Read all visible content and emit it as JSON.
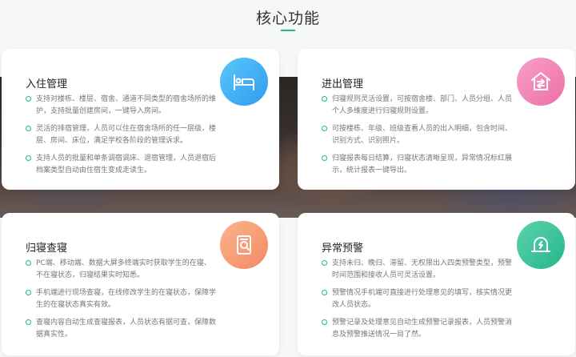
{
  "page": {
    "title": "核心功能"
  },
  "cards": [
    {
      "title": "入住管理",
      "icon": "bed-icon",
      "items": [
        "支持对楼栋、楼层、宿舍、通道不同类型的宿舍场所的维护，支持批量创建房间，一键导入房间。",
        "灵活的排宿管理，人员可以住在宿舍场所的任一层级，楼层、房间、床位，满足学校各阶段的管理诉求。",
        "支持人员的批量和单条调宿调床、退宿管理，人员退宿后档案类型自动由住宿生变成走读生。"
      ]
    },
    {
      "title": "进出管理",
      "icon": "building-in-out-icon",
      "items": [
        "归寝规则灵活设置，可按宿舍楼、部门、人员分组、人员个人多维度进行归寝规则设置。",
        "可按楼栋、年级、班级查看人员的出入明细，包含时间、识别方式、识别照片。",
        "归寝报表每日结算，归寝状态清晰呈现，异常情况标红展示，统计报表一键导出。"
      ]
    },
    {
      "title": "归寝查寝",
      "icon": "dorm-check-icon",
      "items": [
        "PC端、移动端、数据大屏多终端实时获取学生的在寝、不在寝状态，归寝结果实时知悉。",
        "手机端进行现场查寝，在线修改学生的在寝状态，保障学生的在寝状态真实有效。",
        "查寝内容自动生成查寝报表，人员状态有据可查，保障数据真实性。"
      ]
    },
    {
      "title": "异常预警",
      "icon": "alarm-icon",
      "items": [
        "支持未归、晚归、滞留、无权限出入四类预警类型，预警时间范围和接收人员可灵活设置。",
        "预警情况手机端可直接进行处理意见的填写，核实情况更改人员状态。",
        "预警记录及处理意见自动生成预警记录报表，人员预警消息及预警推送情况一目了然。"
      ]
    }
  ],
  "colors": {
    "accent": "#1db88a"
  }
}
